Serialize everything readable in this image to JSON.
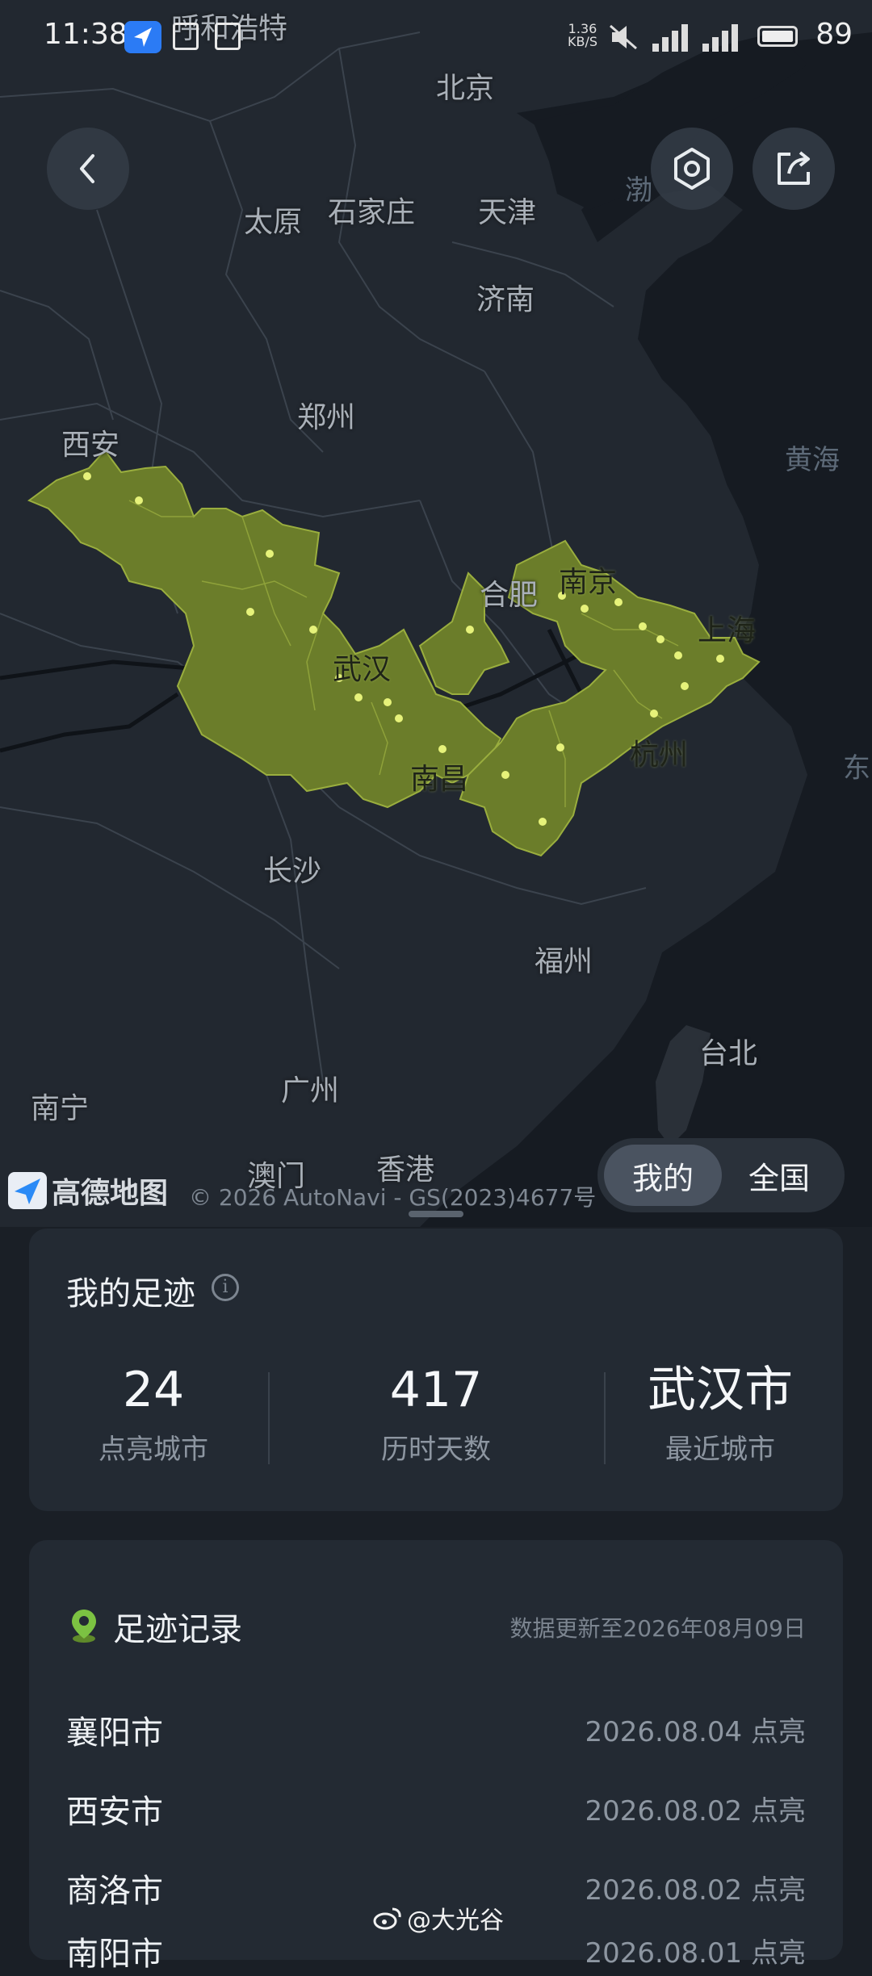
{
  "status_bar": {
    "time": "11:38",
    "net_speed_value": "1.36",
    "net_speed_unit": "KB/S",
    "battery": "89"
  },
  "map": {
    "cities": [
      {
        "name": "呼和浩特"
      },
      {
        "name": "北京"
      },
      {
        "name": "太原"
      },
      {
        "name": "石家庄"
      },
      {
        "name": "天津"
      },
      {
        "name": "济南"
      },
      {
        "name": "郑州"
      },
      {
        "name": "西安"
      },
      {
        "name": "合肥"
      },
      {
        "name": "南京"
      },
      {
        "name": "上海"
      },
      {
        "name": "武汉"
      },
      {
        "name": "杭州"
      },
      {
        "name": "南昌"
      },
      {
        "name": "长沙"
      },
      {
        "name": "福州"
      },
      {
        "name": "台北"
      },
      {
        "name": "广州"
      },
      {
        "name": "南宁"
      },
      {
        "name": "澳门"
      },
      {
        "name": "香港"
      }
    ],
    "seas": [
      "渤",
      "黄海",
      "东"
    ],
    "highlight_color": "#6b7d2a",
    "dot_color": "#e6f27a",
    "logo_text": "高德地图",
    "copyright": "© 2026 AutoNavi - GS(2023)4677号"
  },
  "toggle": {
    "mine": "我的",
    "national": "全国",
    "selected": "我的"
  },
  "footprint": {
    "title": "我的足迹",
    "stats": [
      {
        "value": "24",
        "label": "点亮城市"
      },
      {
        "value": "417",
        "label": "历时天数"
      },
      {
        "value": "武汉市",
        "label": "最近城市"
      }
    ]
  },
  "records": {
    "title": "足迹记录",
    "updated": "数据更新至2026年08月09日",
    "items": [
      {
        "city": "襄阳市",
        "date": "2026.08.04 点亮"
      },
      {
        "city": "西安市",
        "date": "2026.08.02 点亮"
      },
      {
        "city": "商洛市",
        "date": "2026.08.02 点亮"
      },
      {
        "city": "南阳市",
        "date": "2026.08.01 点亮"
      }
    ]
  },
  "watermark": "@大光谷",
  "icons": {
    "back": "chevron-left-icon",
    "settings": "hexagon-settings-icon",
    "share": "share-icon",
    "info": "info-icon",
    "location_pin": "location-pin-icon"
  }
}
